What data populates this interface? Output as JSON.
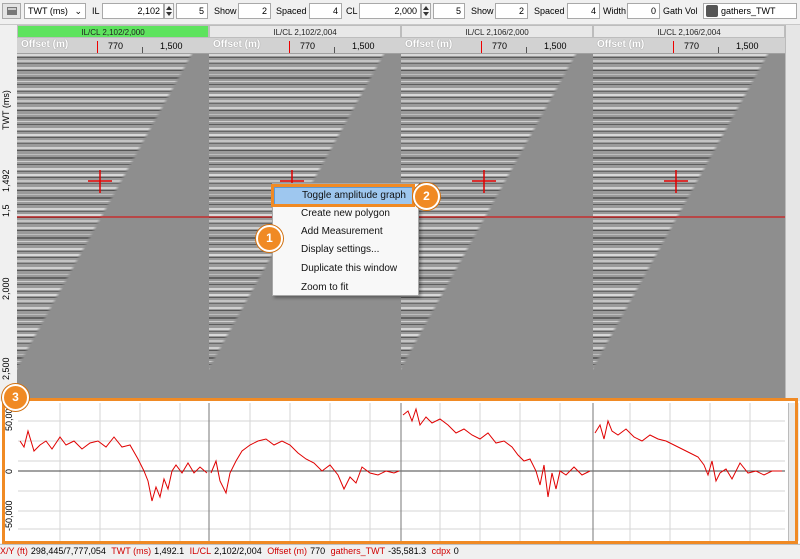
{
  "toolbar": {
    "domain_select": "TWT (ms)",
    "il_label": "IL",
    "il_value": "2,102",
    "il_step": "5",
    "show_label": "Show",
    "show_value": "2",
    "spaced_label": "Spaced",
    "spaced_value": "4",
    "cl_label": "CL",
    "cl_value": "2,000",
    "cl_step": "5",
    "show2_label": "Show",
    "show2_value": "2",
    "spaced2_label": "Spaced",
    "spaced2_value": "4",
    "width_label": "Width",
    "width_value": "0",
    "gathvol_label": "Gath Vol",
    "gathvol_value": "gathers_TWT"
  },
  "panels": [
    {
      "title": "IL/CL 2,102/2,000",
      "axis": "Offset (m)",
      "tick1": "770",
      "tick2": "1,500"
    },
    {
      "title": "IL/CL 2,102/2,004",
      "axis": "Offset (m)",
      "tick1": "770",
      "tick2": "1,500"
    },
    {
      "title": "IL/CL 2,106/2,000",
      "axis": "Offset (m)",
      "tick1": "770",
      "tick2": "1,500"
    },
    {
      "title": "IL/CL 2,106/2,004",
      "axis": "Offset (m)",
      "tick1": "770",
      "tick2": "1,500"
    }
  ],
  "left_axis": {
    "label": "TWT (ms)",
    "ticks": [
      "1,492",
      "1,5",
      "2,000",
      "2,500"
    ]
  },
  "context_menu": {
    "items": [
      "Toggle amplitude graph",
      "Create new polygon",
      "Add Measurement",
      "Display settings...",
      "Duplicate this window",
      "Zoom to fit"
    ]
  },
  "callouts": [
    "1",
    "2",
    "3"
  ],
  "amp_graph": {
    "y_ticks": [
      "50,000",
      "0",
      "-50,000"
    ]
  },
  "status": {
    "xy_label": "X/Y (ft)",
    "xy_value": "298,445/7,777,054",
    "twt_label": "TWT (ms)",
    "twt_value": "1,492.1",
    "ilcl_label": "IL/CL",
    "ilcl_value": "2,102/2,004",
    "offset_label": "Offset (m)",
    "offset_value": "770",
    "gathers_label": "gathers_TWT",
    "gathers_value": "-35,581.3",
    "cdpx_label": "cdpx",
    "cdpx_value": "0"
  },
  "colors": {
    "accent": "#f08a24",
    "active_panel": "#5ee35e",
    "menu_highlight": "#9ec7ef",
    "amp_trace": "#e00000",
    "cursor": "#e00000"
  }
}
